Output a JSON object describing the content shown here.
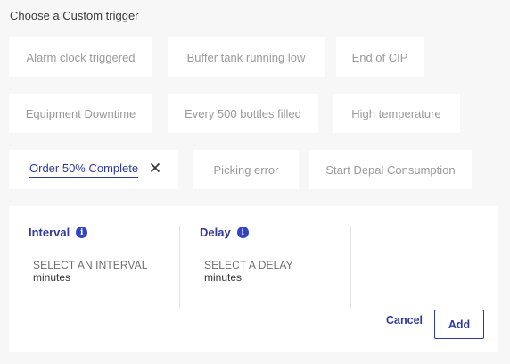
{
  "heading": "Choose a Custom trigger",
  "triggers": [
    {
      "label": "Alarm clock triggered"
    },
    {
      "label": "Buffer tank running low"
    },
    {
      "label": "End of CIP"
    },
    {
      "label": "Equipment Downtime"
    },
    {
      "label": "Every 500 bottles filled"
    },
    {
      "label": "High temperature"
    },
    {
      "label": "Order 50% Complete",
      "selected": true
    },
    {
      "label": "Picking error"
    },
    {
      "label": "Start Depal Consumption"
    }
  ],
  "interval": {
    "label": "Interval",
    "placeholder": "SELECT AN INTERVAL",
    "unit": "minutes"
  },
  "delay": {
    "label": "Delay",
    "placeholder": "SELECT A DELAY",
    "unit": "minutes"
  },
  "actions": {
    "cancel_label": "Cancel",
    "add_label": "Add"
  },
  "icons": {
    "info": "info-icon",
    "remove": "close-icon"
  },
  "colors": {
    "accent": "#2f3a99",
    "info": "#3344c1",
    "muted_text": "#9a9a9a",
    "background": "#f7f7f8"
  }
}
